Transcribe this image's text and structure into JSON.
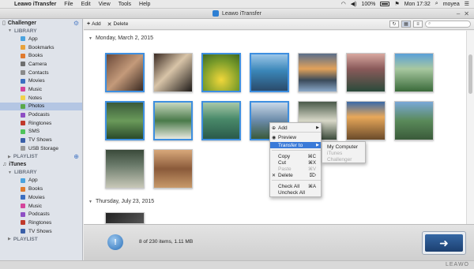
{
  "menubar": {
    "app_name": "Leawo iTransfer",
    "items": [
      "File",
      "Edit",
      "View",
      "Tools",
      "Help"
    ],
    "battery": "100%",
    "clock": "Mon 17:32",
    "user": "moyea"
  },
  "window": {
    "title": "Leawo iTransfer"
  },
  "sidebar": {
    "device_challenger": "Challenger",
    "library_label": "LIBRARY",
    "library_items": [
      {
        "label": "App",
        "color": "#4aa3df"
      },
      {
        "label": "Bookmarks",
        "color": "#e8a23b"
      },
      {
        "label": "Books",
        "color": "#e07a2e"
      },
      {
        "label": "Camera",
        "color": "#6f6f6f"
      },
      {
        "label": "Contacts",
        "color": "#8a8a8a"
      },
      {
        "label": "Movies",
        "color": "#3c6fc1"
      },
      {
        "label": "Music",
        "color": "#d4459b"
      },
      {
        "label": "Notes",
        "color": "#f1d24a"
      },
      {
        "label": "Photos",
        "color": "#5aa84a"
      },
      {
        "label": "Podcasts",
        "color": "#8e4fc4"
      },
      {
        "label": "Ringtones",
        "color": "#c0392b"
      },
      {
        "label": "SMS",
        "color": "#4fc35a"
      },
      {
        "label": "TV Shows",
        "color": "#3a5fa8"
      },
      {
        "label": "USB Storage",
        "color": "#9a9a9a"
      }
    ],
    "playlist_label": "PLAYLIST",
    "device_itunes": "iTunes",
    "itunes_library_label": "LIBRARY",
    "itunes_items": [
      {
        "label": "App",
        "color": "#4aa3df"
      },
      {
        "label": "Books",
        "color": "#e07a2e"
      },
      {
        "label": "Movies",
        "color": "#3c6fc1"
      },
      {
        "label": "Music",
        "color": "#d4459b"
      },
      {
        "label": "Podcasts",
        "color": "#8e4fc4"
      },
      {
        "label": "Ringtones",
        "color": "#c0392b"
      },
      {
        "label": "TV Shows",
        "color": "#3a5fa8"
      }
    ],
    "itunes_playlist_label": "PLAYLIST"
  },
  "toolbar": {
    "add_label": "Add",
    "delete_label": "Delete"
  },
  "content": {
    "date_group_1": "Monday, March 2, 2015",
    "date_group_2": "Thursday, July 23, 2015"
  },
  "context_menu": {
    "add": "Add",
    "preview": "Preview",
    "transfer_to": "Transfer to",
    "copy": "Copy",
    "copy_shortcut": "⌘C",
    "cut": "Cut",
    "cut_shortcut": "⌘X",
    "paste": "Paste",
    "paste_shortcut": "⌘V",
    "delete": "Delete",
    "delete_shortcut": "⌦",
    "check_all": "Check All",
    "check_all_shortcut": "⌘A",
    "uncheck_all": "Uncheck All"
  },
  "submenu": {
    "my_computer": "My Computer",
    "itunes": "iTunes",
    "challenger": "Challenger"
  },
  "footer": {
    "status": "8 of 230 items, 1.11 MB"
  },
  "brand": "LEAWO",
  "colors": {
    "selection_blue": "#3e8fe0",
    "menu_highlight": "#3a7ad8",
    "sidebar_bg": "#dfe3ea",
    "transfer_button": "#1c3f70"
  }
}
